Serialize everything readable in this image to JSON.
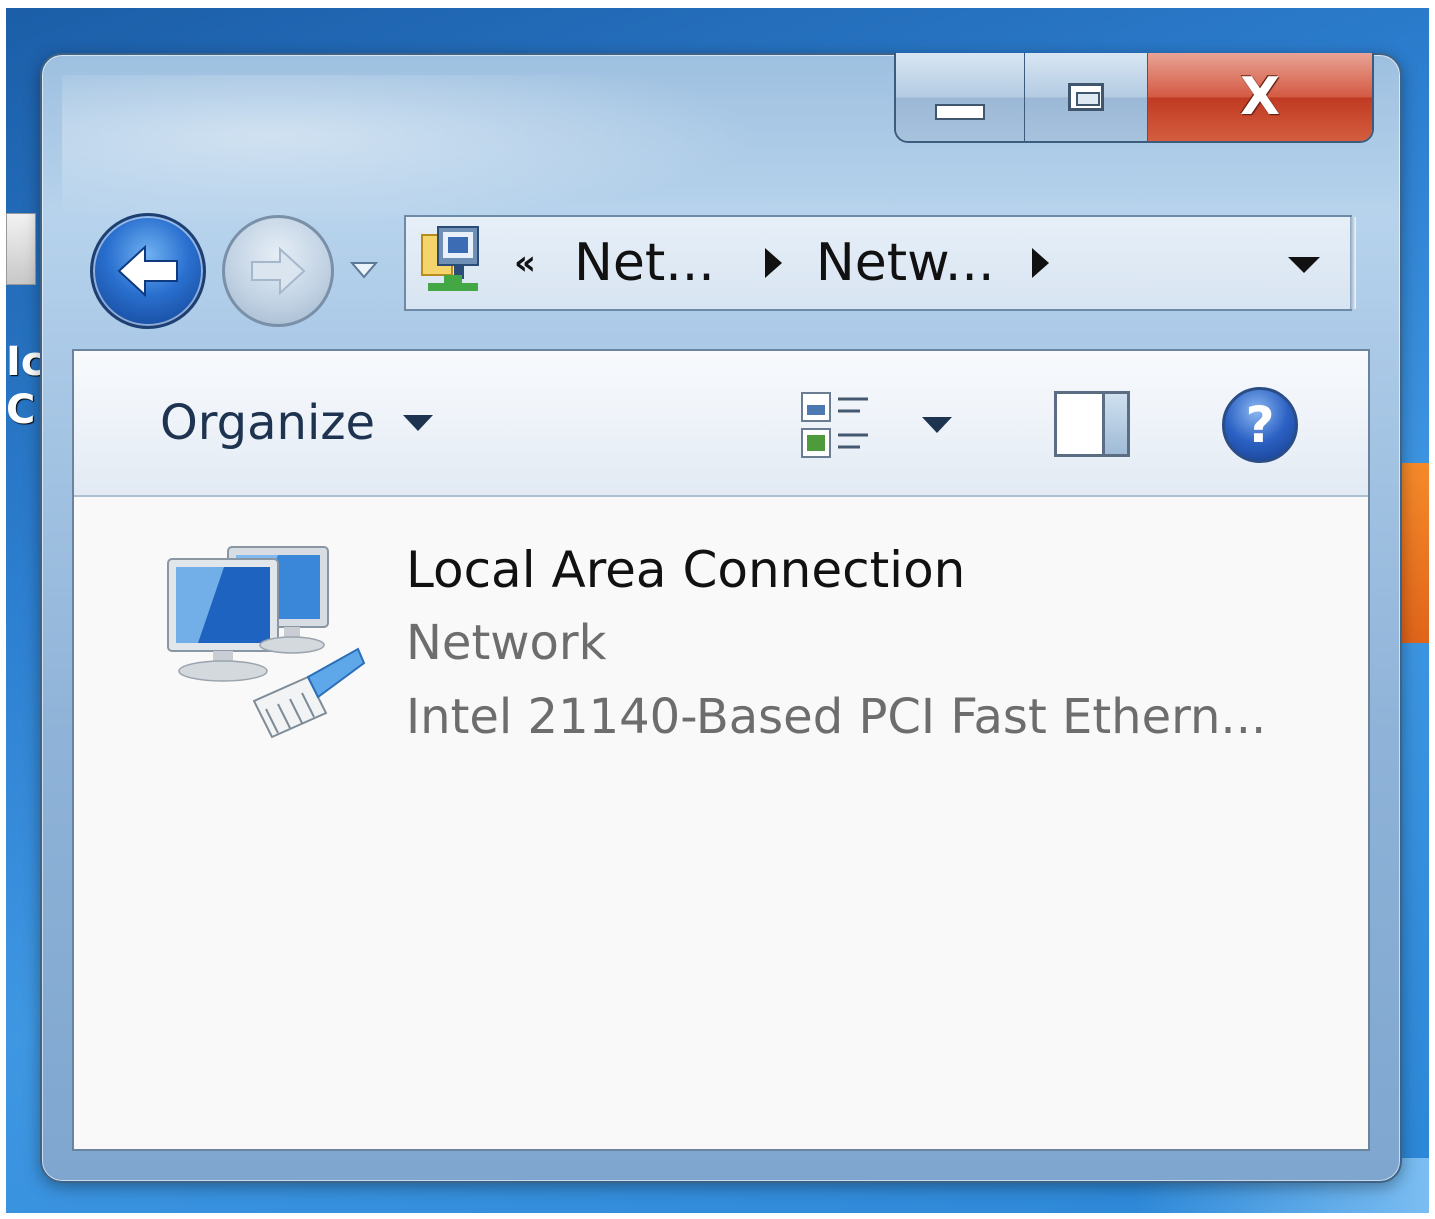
{
  "window": {
    "close_glyph": "X"
  },
  "address_bar": {
    "overflow_chevron": "«",
    "segments": [
      "Net...",
      "Netw..."
    ]
  },
  "toolbar": {
    "organize_label": "Organize"
  },
  "connection": {
    "name": "Local Area Connection",
    "network": "Network",
    "adapter": "Intel 21140-Based PCI Fast Ethern..."
  },
  "help": {
    "glyph": "?"
  },
  "icons": {
    "back": "back-arrow-icon",
    "forward": "forward-arrow-icon",
    "recent": "recent-pages-dropdown-icon",
    "address": "network-connections-folder-icon",
    "views": "change-view-icon",
    "preview": "preview-pane-icon",
    "help": "help-icon",
    "connection": "network-adapter-icon"
  },
  "colors": {
    "close_button": "#c03a22",
    "nav_back": "#2a70cf",
    "help": "#2c62c4"
  }
}
